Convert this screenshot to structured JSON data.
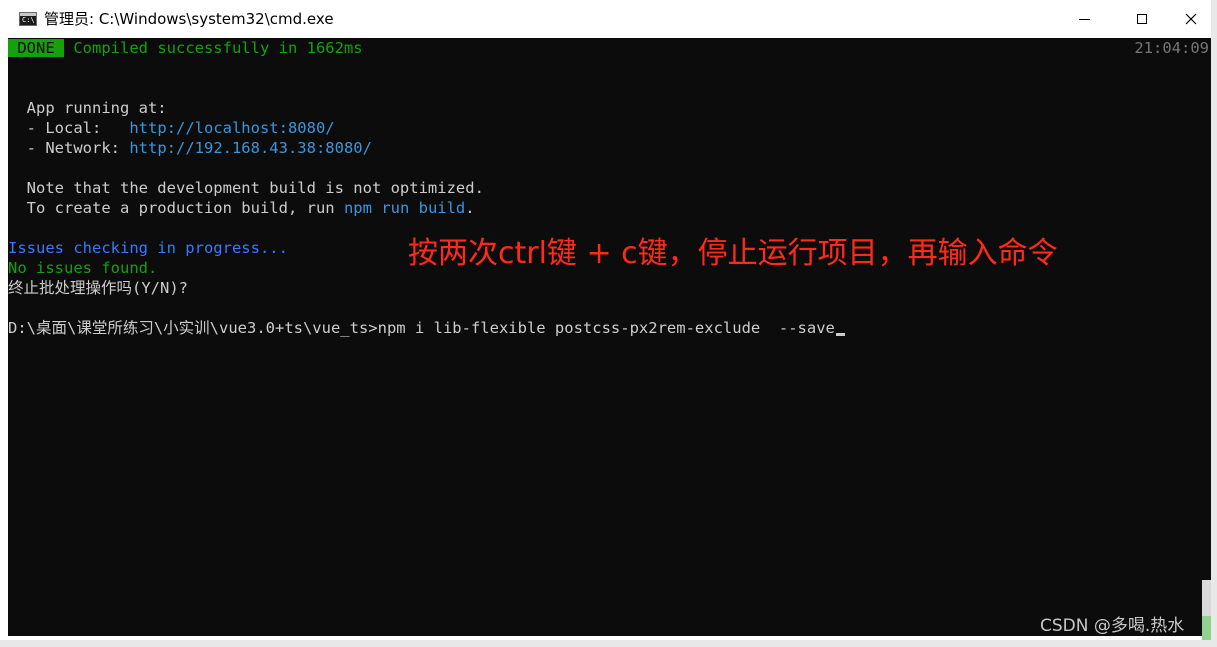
{
  "window": {
    "title": "管理员: C:\\Windows\\system32\\cmd.exe",
    "app_icon_glyph": "C:\\"
  },
  "terminal": {
    "done_badge": " DONE ",
    "compiled_msg": " Compiled successfully in 1662ms",
    "timestamp": "21:04:09",
    "app_running": "  App running at:",
    "local_prefix": "  - Local:   ",
    "local_url": "http://localhost:8080/",
    "network_prefix": "  - Network: ",
    "network_url": "http://192.168.43.38:8080/",
    "note_line": "  Note that the development build is not optimized.",
    "prod_prefix": "  To create a production build, run ",
    "prod_cmd": "npm run build",
    "prod_suffix": ".",
    "issues_checking": "Issues checking in progress...",
    "no_issues": "No issues found.",
    "terminate_prompt": "终止批处理操作吗(Y/N)?",
    "command_line": "D:\\桌面\\课堂所练习\\小实训\\vue3.0+ts\\vue_ts>npm i lib-flexible postcss-px2rem-exclude  --save"
  },
  "annotation": "按两次ctrl键 + c键，停止运行项目，再输入命令",
  "watermark": "CSDN @多喝.热水",
  "colors": {
    "terminal_bg": "#0c0c0c",
    "terminal_text": "#cccccc",
    "green": "#13a10e",
    "cyan": "#3a96dd",
    "blue": "#3b78ff",
    "annotation_red": "#ff2a1a"
  }
}
